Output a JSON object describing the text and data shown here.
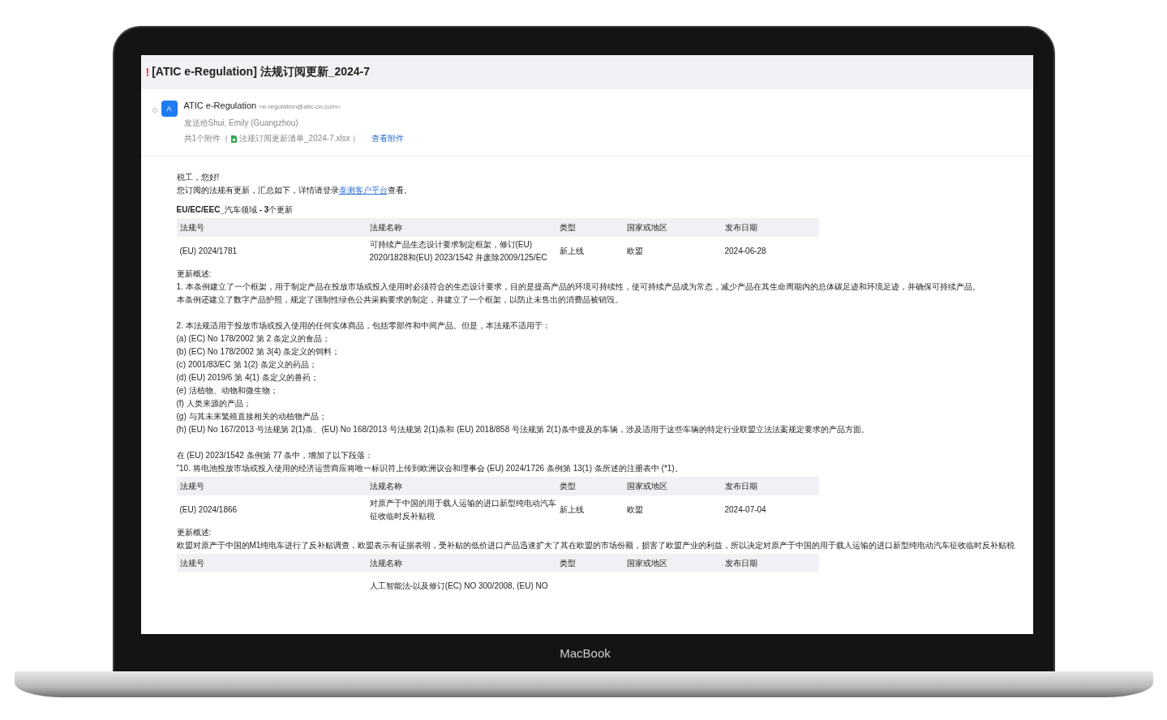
{
  "subject": {
    "flag": "!",
    "text": "[ATIC e-Regulation] 法规订阅更新_2024-7"
  },
  "sender": {
    "avatar": "A",
    "name": "ATIC e-Regulation",
    "address": "<e-regulation@atic-cn.com>"
  },
  "recipients": "发送给Shui, Emily (Guangzhou)",
  "attachments": {
    "summary": "共1个附件（",
    "file": "法规订阅更新清单_2024-7.xlsx",
    "end": "）",
    "view_link": "查看附件"
  },
  "body": {
    "greeting": "税工，您好!",
    "intro": {
      "before": "您订阅的法规有更新，汇总如下，详情请登录",
      "link": "泰测客户平台",
      "after": "查看。"
    },
    "section_title": "**EU/EC/EEC_**汽车领域 **- 3**个更新",
    "blocks": [
      {
        "columns": [
          "法规号",
          "法规名称",
          "类型",
          "国家或地区",
          "发布日期"
        ],
        "row": {
          "number": "(EU) 2024/1781",
          "name": "可持续产品生态设计要求制定框架，修订(EU) 2020/1828和(EU) 2023/1542 并废除2009/125/EC",
          "type": "新上线",
          "region": "欧盟",
          "date": "2024-06-28"
        },
        "summary_label": "更新概述:",
        "paragraphs": [
          [
            "1. 本条例建立了一个框架，用于制定产品在投放市场或投入使用时必须符合的生态设计要求，目的是提高产品的环境可持续性，使可持续产品成为常态，减少产品在其生命周期内的总体碳足迹和环境足迹，并确保可持续产品。",
            "本条例还建立了数字产品护照，规定了强制性绿色公共采购要求的制定，并建立了一个框架，以防止未售出的消费品被销毁。"
          ],
          [
            "2. 本法规适用于投放市场或投入使用的任何实体商品，包括零部件和中间产品。但是，本法规不适用于：",
            "(a) (EC) No 178/2002 第 2 条定义的食品；",
            "(b) (EC) No 178/2002 第 3(4) 条定义的饲料；",
            "(c) 2001/83/EC 第 1(2) 条定义的药品；",
            "(d) (EU) 2019/6 第 4(1) 条定义的兽药；",
            "(e) 活植物、动物和微生物；",
            "(f) 人类来源的产品；",
            "(g) 与其未来繁殖直接相关的动植物产品；",
            "(h) (EU) No 167/2013 号法规第 2(1)条、(EU) No 168/2013 号法规第 2(1)条和 (EU) 2018/858 号法规第 2(1)条中提及的车辆，涉及适用于这些车辆的特定行业联盟立法法案规定要求的产品方面。"
          ],
          [
            "在 (EU) 2023/1542 条例第 77 条中，增加了以下段落：",
            "\"10. 将电池投放市场或投入使用的经济运营商应将唯一标识符上传到欧洲议会和理事会 (EU) 2024/1726 条例第 13(1) 条所述的注册表中 (*1)。"
          ]
        ]
      },
      {
        "columns": [
          "法规号",
          "法规名称",
          "类型",
          "国家或地区",
          "发布日期"
        ],
        "row": {
          "number": "(EU) 2024/1866",
          "name": "对原产于中国的用于载人运输的进口新型纯电动汽车征收临时反补贴税",
          "type": "新上线",
          "region": "欧盟",
          "date": "2024-07-04"
        },
        "summary_label": "更新概述:",
        "paragraphs": [
          [
            "欧盟对原产于中国的M1纯电车进行了反补贴调查，欧盟表示有证据表明，受补贴的低价进口产品迅速扩大了其在欧盟的市场份额，损害了欧盟产业的利益，所以决定对原产于中国的用于载人运输的进口新型纯电动汽车征收临时反补贴税"
          ]
        ]
      },
      {
        "columns": [
          "法规号",
          "法规名称",
          "类型",
          "国家或地区",
          "发布日期"
        ],
        "row": {
          "name": "人工智能法-以及修订(EC) NO 300/2008, (EU) NO"
        }
      }
    ]
  },
  "device_label": "MacBook"
}
